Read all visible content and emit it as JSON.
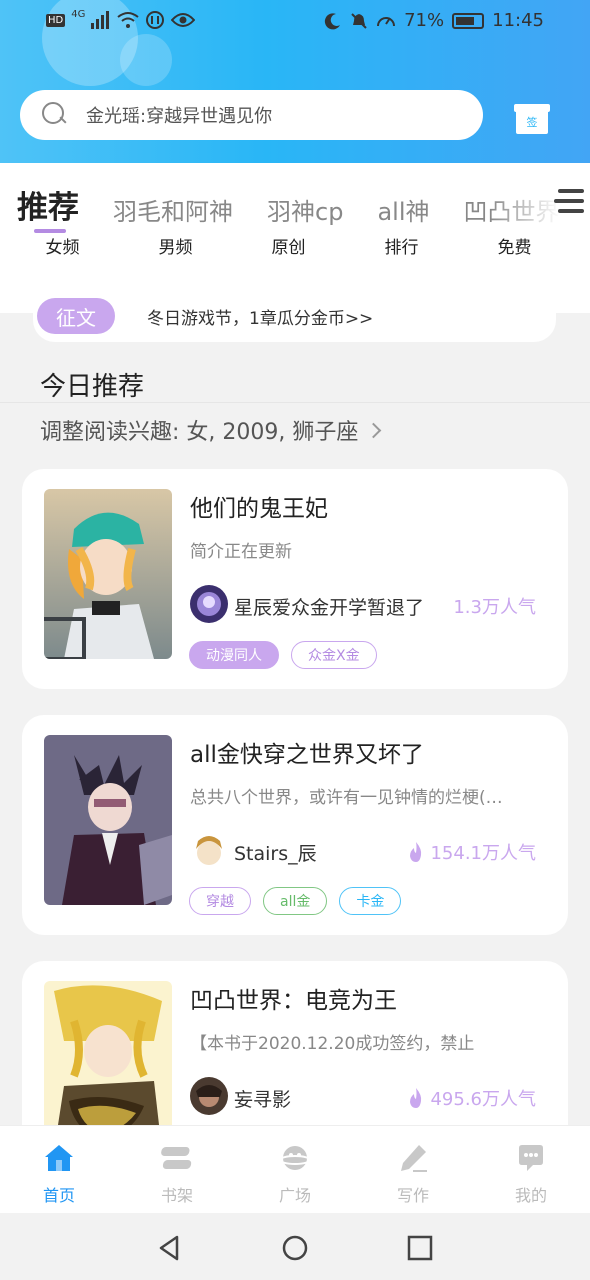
{
  "status_bar": {
    "network": "4G",
    "hd": "HD",
    "battery": "71%",
    "time": "11:45"
  },
  "search": {
    "placeholder": "金光瑶:穿越异世遇见你"
  },
  "gift": {
    "label": "签"
  },
  "tabs": [
    {
      "label": "推荐",
      "active": true
    },
    {
      "label": "羽毛和阿神"
    },
    {
      "label": "羽神cp"
    },
    {
      "label": "all神"
    },
    {
      "label": "凹凸世界"
    }
  ],
  "subnav": [
    "女频",
    "男频",
    "原创",
    "排行",
    "免费"
  ],
  "notice": {
    "badge": "征文",
    "text": "冬日游戏节，1章瓜分金币>>"
  },
  "section": {
    "title": "今日推荐",
    "interest": "调整阅读兴趣: 女, 2009, 狮子座"
  },
  "books": [
    {
      "title": "他们的鬼王妃",
      "description": "简介正在更新",
      "author": "星辰爱众金开学暂退了",
      "popularity": "1.3万人气",
      "tags": [
        {
          "label": "动漫同人",
          "style": "filled",
          "color": "#c9a7ee"
        },
        {
          "label": "众金X金",
          "style": "outline",
          "color": "#c9a7ee"
        }
      ]
    },
    {
      "title": "all金快穿之世界又坏了",
      "description": "总共八个世界，或许有一见钟情的烂梗(…",
      "author": "Stairs_辰",
      "popularity": "154.1万人气",
      "tags": [
        {
          "label": "穿越",
          "style": "outline",
          "color": "#c9a7ee"
        },
        {
          "label": "all金",
          "style": "outline",
          "color": "#81c784"
        },
        {
          "label": "卡金",
          "style": "outline",
          "color": "#4fc3f7"
        }
      ]
    },
    {
      "title": "凹凸世界：电竞为王",
      "description": "【本书于2020.12.20成功签约，禁止",
      "author": "妄寻影",
      "popularity": "495.6万人气",
      "tags": []
    }
  ],
  "bottom_nav": [
    {
      "label": "首页",
      "icon": "home-icon",
      "active": true
    },
    {
      "label": "书架",
      "icon": "bookshelf-icon"
    },
    {
      "label": "广场",
      "icon": "planet-icon"
    },
    {
      "label": "写作",
      "icon": "pen-icon"
    },
    {
      "label": "我的",
      "icon": "chat-icon"
    }
  ],
  "colors": {
    "accent": "#b48be2",
    "header": "#29b6f6",
    "nav_active": "#2196f3"
  }
}
